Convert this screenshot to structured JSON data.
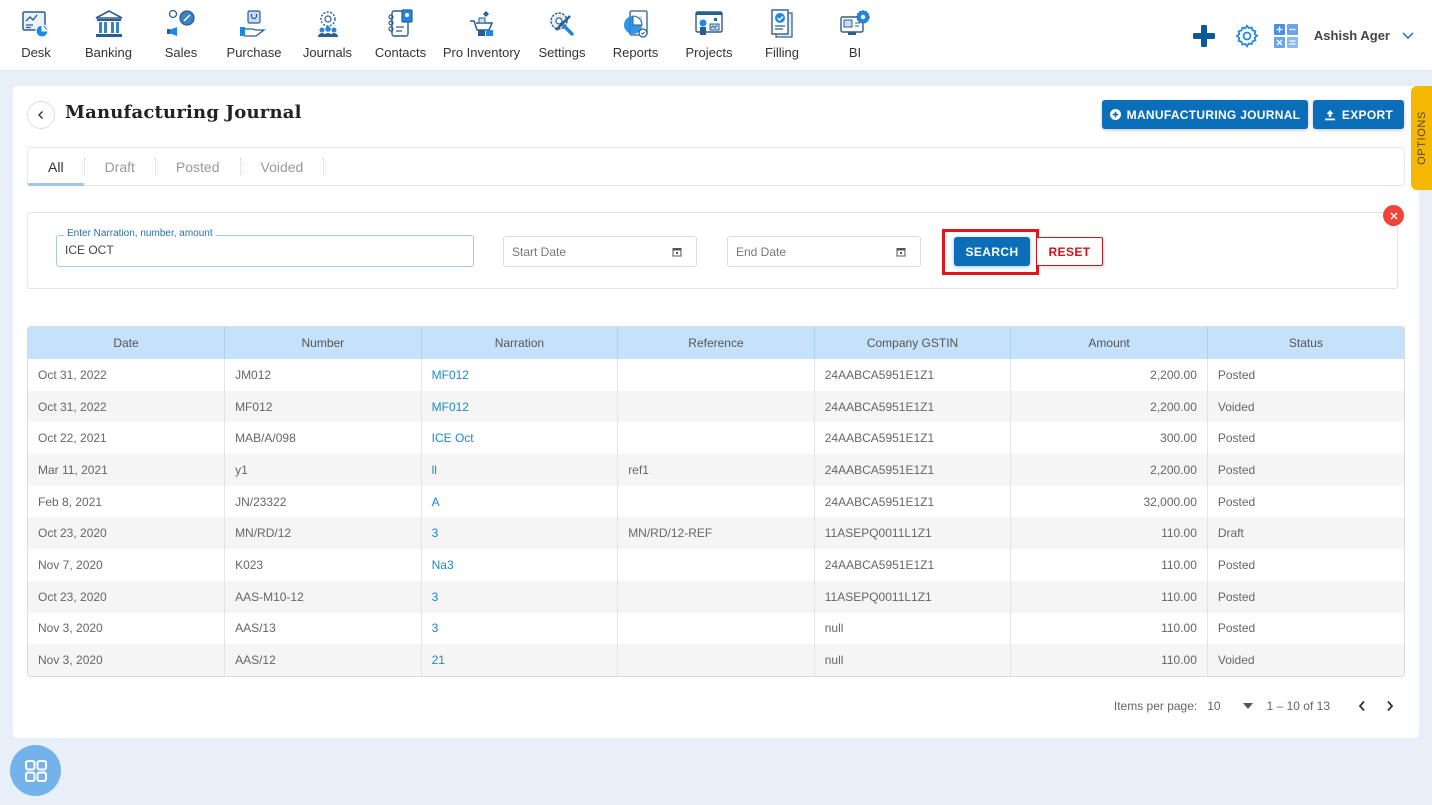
{
  "nav": {
    "items": [
      {
        "label": "Desk",
        "icon": "desk-icon"
      },
      {
        "label": "Banking",
        "icon": "bank-icon"
      },
      {
        "label": "Sales",
        "icon": "sales-icon"
      },
      {
        "label": "Purchase",
        "icon": "purchase-icon"
      },
      {
        "label": "Journals",
        "icon": "journals-icon"
      },
      {
        "label": "Contacts",
        "icon": "contacts-icon"
      },
      {
        "label": "Pro Inventory",
        "icon": "inventory-icon"
      },
      {
        "label": "Settings",
        "icon": "settings-tools-icon"
      },
      {
        "label": "Reports",
        "icon": "reports-icon"
      },
      {
        "label": "Projects",
        "icon": "projects-icon"
      },
      {
        "label": "Filling",
        "icon": "filling-icon"
      },
      {
        "label": "BI",
        "icon": "bi-icon"
      }
    ],
    "user_name": "Ashish Ager"
  },
  "colors": {
    "primary": "#0a6fb8",
    "accent_yellow": "#f5b800",
    "danger": "#d3121b",
    "link": "#1e88c8",
    "header_bg": "#c6e1fa"
  },
  "page": {
    "title": "Manufacturing Journal",
    "add_button": "MANUFACTURING JOURNAL",
    "export_button": "EXPORT",
    "options_label": "OPTIONS"
  },
  "tabs": [
    {
      "label": "All",
      "active": true
    },
    {
      "label": "Draft",
      "active": false
    },
    {
      "label": "Posted",
      "active": false
    },
    {
      "label": "Voided",
      "active": false
    }
  ],
  "filters": {
    "search_label": "Enter Narration, number, amount",
    "search_value": "ICE OCT",
    "start_date_placeholder": "Start Date",
    "end_date_placeholder": "End Date",
    "search_button": "SEARCH",
    "reset_button": "RESET"
  },
  "table": {
    "columns": [
      "Date",
      "Number",
      "Narration",
      "Reference",
      "Company GSTIN",
      "Amount",
      "Status"
    ],
    "rows": [
      {
        "date": "Oct 31, 2022",
        "number": "JM012",
        "narration": "MF012",
        "reference": "",
        "gstin": "24AABCA5951E1Z1",
        "amount": "2,200.00",
        "status": "Posted"
      },
      {
        "date": "Oct 31, 2022",
        "number": "MF012",
        "narration": "MF012",
        "reference": "",
        "gstin": "24AABCA5951E1Z1",
        "amount": "2,200.00",
        "status": "Voided"
      },
      {
        "date": "Oct 22, 2021",
        "number": "MAB/A/098",
        "narration": "ICE Oct",
        "reference": "",
        "gstin": "24AABCA5951E1Z1",
        "amount": "300.00",
        "status": "Posted"
      },
      {
        "date": "Mar 11, 2021",
        "number": "y1",
        "narration": "ll",
        "reference": "ref1",
        "gstin": "24AABCA5951E1Z1",
        "amount": "2,200.00",
        "status": "Posted"
      },
      {
        "date": "Feb 8, 2021",
        "number": "JN/23322",
        "narration": "A",
        "reference": "",
        "gstin": "24AABCA5951E1Z1",
        "amount": "32,000.00",
        "status": "Posted"
      },
      {
        "date": "Oct 23, 2020",
        "number": "MN/RD/12",
        "narration": "3",
        "reference": "MN/RD/12-REF",
        "gstin": "11ASEPQ0011L1Z1",
        "amount": "110.00",
        "status": "Draft"
      },
      {
        "date": "Nov 7, 2020",
        "number": "K023",
        "narration": "Na3",
        "reference": "",
        "gstin": "24AABCA5951E1Z1",
        "amount": "110.00",
        "status": "Posted"
      },
      {
        "date": "Oct 23, 2020",
        "number": "AAS-M10-12",
        "narration": "3",
        "reference": "",
        "gstin": "11ASEPQ0011L1Z1",
        "amount": "110.00",
        "status": "Posted"
      },
      {
        "date": "Nov 3, 2020",
        "number": "AAS/13",
        "narration": "3",
        "reference": "",
        "gstin": "null",
        "amount": "110.00",
        "status": "Posted"
      },
      {
        "date": "Nov 3, 2020",
        "number": "AAS/12",
        "narration": "21",
        "reference": "",
        "gstin": "null",
        "amount": "110.00",
        "status": "Voided"
      }
    ]
  },
  "pagination": {
    "items_per_page_label": "Items per page:",
    "items_per_page": "10",
    "range": "1 – 10 of 13"
  }
}
